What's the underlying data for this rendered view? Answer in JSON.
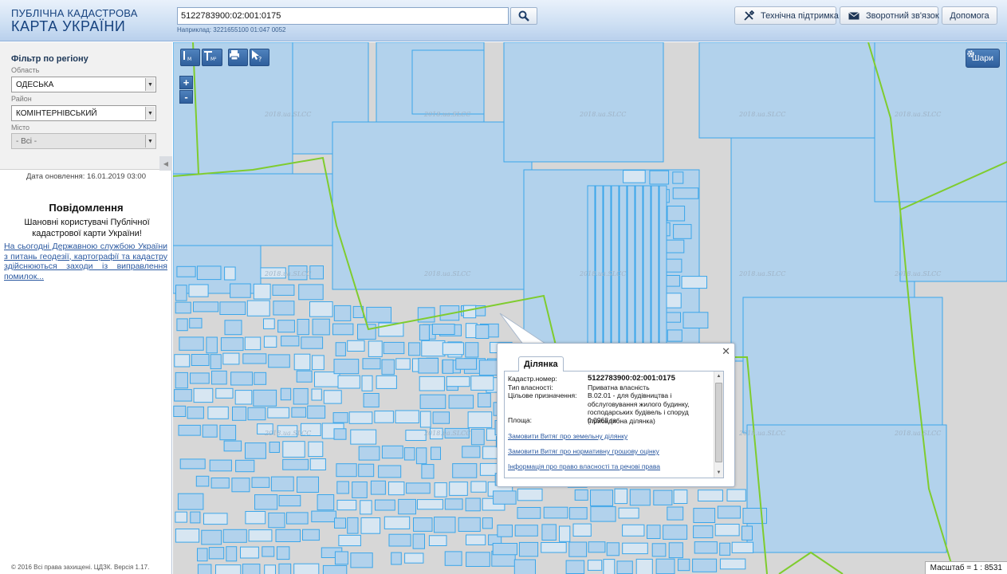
{
  "header": {
    "logo_line1": "ПУБЛІЧНА КАДАСТРОВА",
    "logo_line2": "КАРТА УКРАЇНИ",
    "search_value": "5122783900:02:001:0175",
    "search_hint": "Наприклад: 3221655100 01:047 0052",
    "buttons": {
      "support": "Технічна підтримка",
      "feedback": "Зворотний зв'язок",
      "help": "Допомога"
    }
  },
  "sidebar": {
    "filter_title": "Фільтр по регіону",
    "region_label": "Область",
    "region_value": "ОДЕСЬКА",
    "district_label": "Район",
    "district_value": "КОМІНТЕРНІВСЬКИЙ",
    "city_label": "Місто",
    "city_value": "- Всі -",
    "updated": "Дата оновлення: 16.01.2019 03:00",
    "news_title": "Повідомлення",
    "news_body": "Шановні користувачі Публічної кадастрової карти України!",
    "news_link": "На сьогодні Державною службою України з питань геодезії, картографії та кадастру здійснюються заходи із виправлення помилок...",
    "copyright": "© 2016 Всі права захищені. ЦДЗК. Версія 1.17."
  },
  "map": {
    "layers_label": "Шари",
    "zoom_in": "+",
    "zoom_out": "-",
    "scale_label": "Масштаб = 1 : 8531",
    "watermark": "2018.ua.SLCC",
    "colors": {
      "parcel_fill": "#b2d2ec",
      "parcel_stroke": "#3ba6ea",
      "boundary": "#7fcc2e",
      "road": "#d7d7d7"
    }
  },
  "popup": {
    "tab": "Ділянка",
    "fields": [
      {
        "key": "Кадастр.номер:",
        "value": "5122783900:02:001:0175"
      },
      {
        "key": "Тип власності:",
        "value": "Приватна власність"
      },
      {
        "key": "Цільове призначення:",
        "value": "В.02.01 - для будівництва і обслуговування жилого будинку, господарських будівель і споруд (присадибна ділянка)"
      },
      {
        "key": "Площа:",
        "value": "0.0968 га"
      }
    ],
    "links": [
      "Замовити Витяг про земельну ділянку",
      "Замовити Витяг про нормативну грошову оцінку",
      "Інформація про право власності та речові права"
    ]
  }
}
